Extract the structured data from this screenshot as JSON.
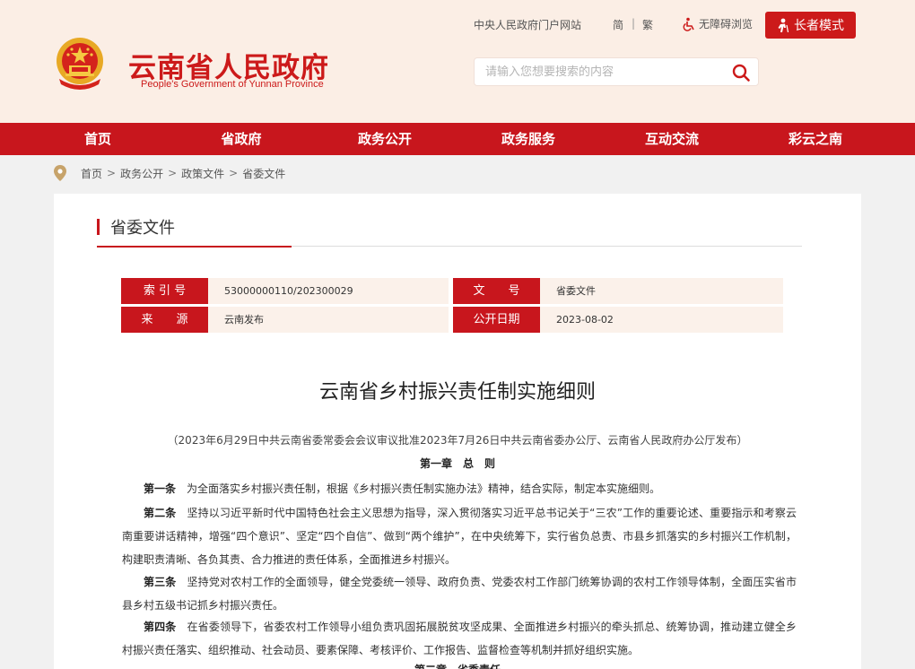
{
  "header": {
    "site_name": "云南省人民政府",
    "site_name_en": "People's Government of Yunnan Province",
    "portal_link": "中央人民政府门户网站",
    "simplified": "简",
    "separator": "|",
    "traditional": "繁",
    "accessibility": "无障碍浏览",
    "elder_mode": "长者模式",
    "search_placeholder": "请输入您想要搜索的内容"
  },
  "nav": {
    "items": [
      {
        "label": "首页"
      },
      {
        "label": "省政府"
      },
      {
        "label": "政务公开"
      },
      {
        "label": "政务服务"
      },
      {
        "label": "互动交流"
      },
      {
        "label": "彩云之南"
      }
    ]
  },
  "breadcrumb": {
    "items": [
      "首页",
      "政务公开",
      "政策文件",
      "省委文件"
    ],
    "separator": ">"
  },
  "section": {
    "title": "省委文件"
  },
  "meta": {
    "index_label": "索 引 号",
    "index_value": "53000000110/202300029",
    "docno_label": "文　　号",
    "docno_value": "省委文件",
    "source_label": "来　　源",
    "source_value": "云南发布",
    "date_label": "公开日期",
    "date_value": "2023-08-02"
  },
  "article": {
    "title": "云南省乡村振兴责任制实施细则",
    "subtitle": "（2023年6月29日中共云南省委常委会会议审议批准2023年7月26日中共云南省委办公厅、云南省人民政府办公厅发布）",
    "chapter1": "第一章　总　则",
    "paragraphs": [
      {
        "lead": "第一条",
        "text": "为全面落实乡村振兴责任制，根据《乡村振兴责任制实施办法》精神，结合实际，制定本实施细则。"
      },
      {
        "lead": "第二条",
        "text": "坚持以习近平新时代中国特色社会主义思想为指导，深入贯彻落实习近平总书记关于“三农”工作的重要论述、重要指示和考察云南重要讲话精神，增强“四个意识”、坚定“四个自信”、做到“两个维护”，在中央统筹下，实行省负总责、市县乡抓落实的乡村振兴工作机制，构建职责清晰、各负其责、合力推进的责任体系，全面推进乡村振兴。"
      },
      {
        "lead": "第三条",
        "text": "坚持党对农村工作的全面领导，健全党委统一领导、政府负责、党委农村工作部门统筹协调的农村工作领导体制，全面压实省市县乡村五级书记抓乡村振兴责任。"
      },
      {
        "lead": "第四条",
        "text": "在省委领导下，省委农村工作领导小组负责巩固拓展脱贫攻坚成果、全面推进乡村振兴的牵头抓总、统筹协调，推动建立健全乡村振兴责任落实、组织推动、社会动员、要素保障、考核评价、工作报告、监督检查等机制并抓好组织实施。"
      }
    ],
    "chapter2": "第二章　省委责任"
  },
  "colors": {
    "brand_red": "#c8161d",
    "header_bg": "#fbeee5",
    "meta_value_bg": "#fbf1ea",
    "page_bg": "#f1f1f1"
  },
  "icons": {
    "emblem": "national-emblem-icon",
    "accessibility": "wheelchair-icon",
    "elder": "elder-person-icon",
    "search": "search-icon",
    "location": "location-pin-icon"
  }
}
